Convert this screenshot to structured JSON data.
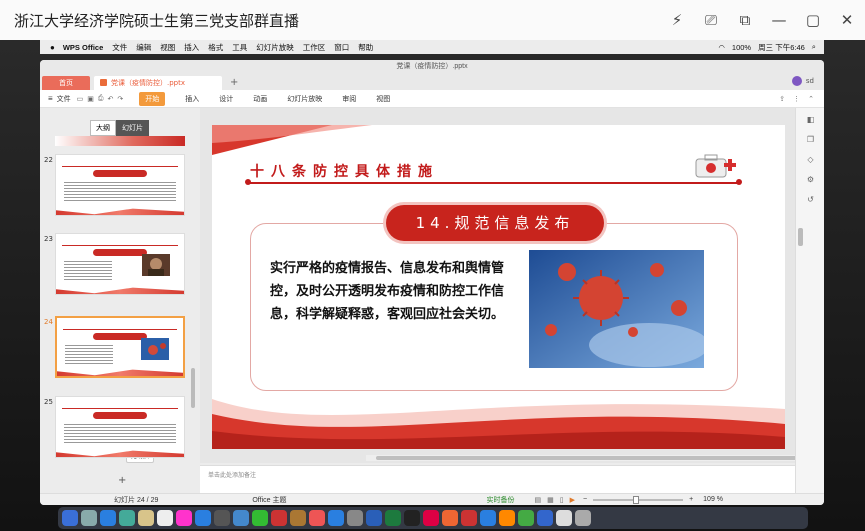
{
  "live": {
    "title": "浙江大学经济学院硕士生第三党支部群直播",
    "controls": [
      "⚡",
      "⎚",
      "⧉",
      "—",
      "▢",
      "✕"
    ]
  },
  "menubar": {
    "app": "WPS Office",
    "items": [
      "文件",
      "编辑",
      "视图",
      "插入",
      "格式",
      "工具",
      "幻灯片放映",
      "工作区",
      "窗口",
      "帮助"
    ],
    "battery": "100%",
    "clock": "周三 下午6:46"
  },
  "window": {
    "title": "党课（疫情防控）.pptx",
    "home_tab": "首页",
    "doc_tab": "党课（疫情防控）.pptx",
    "user": "sd"
  },
  "ribbon": {
    "file": "文件",
    "tabs": [
      "开始",
      "插入",
      "设计",
      "动画",
      "幻灯片放映",
      "审阅",
      "视图"
    ],
    "active_tab": "开始"
  },
  "thumbs": {
    "switch_outline": "大纲",
    "switch_slides": "幻灯片",
    "slides": [
      {
        "num": "22"
      },
      {
        "num": "23"
      },
      {
        "num": "24"
      },
      {
        "num": "25"
      }
    ],
    "tooltip": "无切换",
    "add": "+"
  },
  "slide": {
    "header": "十八条防控具体措施",
    "pill": "14.规范信息发布",
    "body": "实行严格的疫情报告、信息发布和舆情管控，及时公开透明发布疫情和防控工作信息，科学解疑释惑，客观回应社会关切。"
  },
  "notes_placeholder": "单击此处添加备注",
  "status": {
    "slide_counter": "幻灯片 24 / 29",
    "theme": "Office 主题",
    "backup": "实时备份",
    "zoom": "109 %"
  },
  "colors": {
    "brand_red": "#c8241d",
    "wps_orange": "#f39a3c",
    "home_tab": "#ea6c5a"
  }
}
